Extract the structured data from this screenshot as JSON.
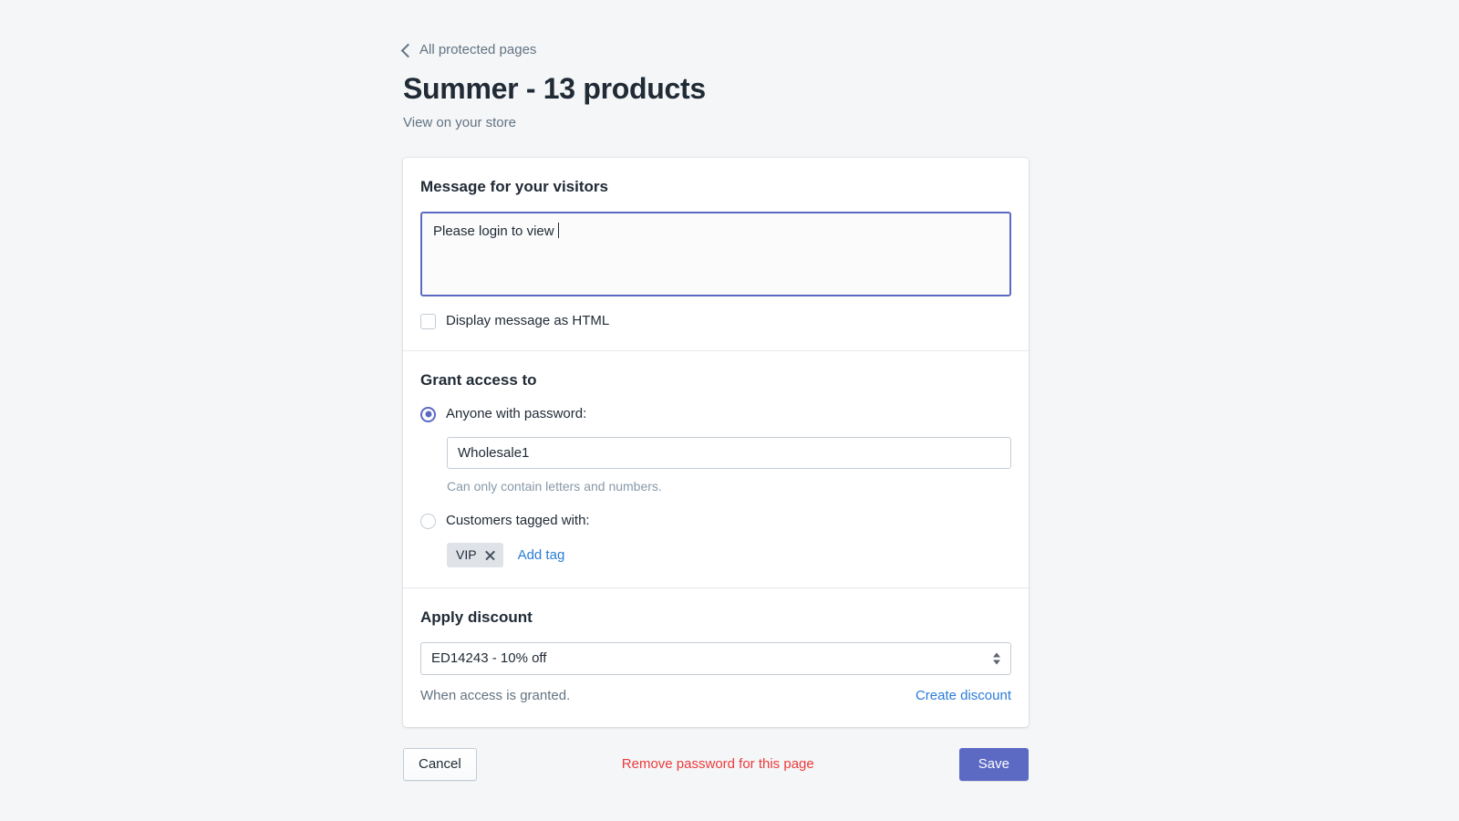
{
  "header": {
    "back_label": "All protected pages",
    "title": "Summer - 13 products",
    "view_store_label": "View on your store"
  },
  "message_section": {
    "title": "Message for your visitors",
    "textarea_value": "Please login to view ",
    "html_checkbox_label": "Display message as HTML"
  },
  "access_section": {
    "title": "Grant access to",
    "password_option_label": "Anyone with password:",
    "password_value": "Wholesale1",
    "password_help": "Can only contain letters and numbers.",
    "tag_option_label": "Customers tagged with:",
    "tags": [
      {
        "text": "VIP"
      }
    ],
    "add_tag_label": "Add tag"
  },
  "discount_section": {
    "title": "Apply discount",
    "selected_discount": "ED14243 - 10% off",
    "footnote": "When access is granted.",
    "create_discount_label": "Create discount"
  },
  "actions": {
    "cancel_label": "Cancel",
    "remove_label": "Remove password for this page",
    "save_label": "Save"
  },
  "colors": {
    "accent_indigo": "#5c6ac4",
    "link_blue": "#2a7cd6",
    "destructive_red": "#ec3b3b",
    "page_bg": "#f4f6f8",
    "text_primary": "#212b36",
    "text_subdued": "#637381"
  }
}
